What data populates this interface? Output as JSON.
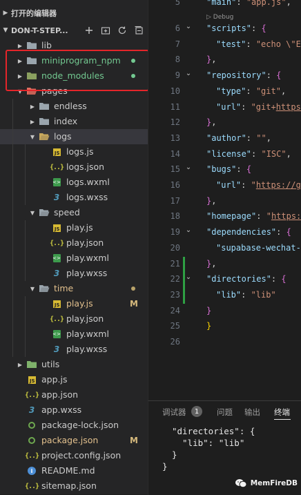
{
  "explorer": {
    "open_editors_label": "打开的编辑器",
    "project_label": "DON-T-STEP...",
    "actions": [
      "new-file-icon",
      "new-folder-icon",
      "refresh-icon",
      "collapse-all-icon"
    ],
    "items": [
      {
        "label": "lib",
        "type": "folder",
        "open": false,
        "indent": 0,
        "color": "#cccccc"
      },
      {
        "label": "miniprogram_npm",
        "type": "folder",
        "open": false,
        "indent": 0,
        "color": "#73c991",
        "dot": true
      },
      {
        "label": "node_modules",
        "type": "folder-node",
        "open": false,
        "indent": 0,
        "color": "#73c991",
        "dot": true
      },
      {
        "label": "pages",
        "type": "folder-pages",
        "open": true,
        "indent": 0,
        "color": "#cccccc"
      },
      {
        "label": "endless",
        "type": "folder",
        "open": false,
        "indent": 1,
        "color": "#cccccc"
      },
      {
        "label": "index",
        "type": "folder",
        "open": false,
        "indent": 1,
        "color": "#cccccc"
      },
      {
        "label": "logs",
        "type": "folder-logs",
        "open": true,
        "indent": 1,
        "color": "#cccccc",
        "selected": true
      },
      {
        "label": "logs.js",
        "type": "js",
        "indent": 2,
        "color": "#cccccc"
      },
      {
        "label": "logs.json",
        "type": "json",
        "indent": 2,
        "color": "#cccccc"
      },
      {
        "label": "logs.wxml",
        "type": "wxml",
        "indent": 2,
        "color": "#cccccc"
      },
      {
        "label": "logs.wxss",
        "type": "wxss",
        "indent": 2,
        "color": "#cccccc"
      },
      {
        "label": "speed",
        "type": "folder",
        "open": true,
        "indent": 1,
        "color": "#cccccc"
      },
      {
        "label": "play.js",
        "type": "js",
        "indent": 2,
        "color": "#cccccc"
      },
      {
        "label": "play.json",
        "type": "json",
        "indent": 2,
        "color": "#cccccc"
      },
      {
        "label": "play.wxml",
        "type": "wxml",
        "indent": 2,
        "color": "#cccccc"
      },
      {
        "label": "play.wxss",
        "type": "wxss",
        "indent": 2,
        "color": "#cccccc"
      },
      {
        "label": "time",
        "type": "folder",
        "open": true,
        "indent": 1,
        "color": "#e2c08d",
        "dotc": true
      },
      {
        "label": "play.js",
        "type": "js",
        "indent": 2,
        "color": "#e2c08d",
        "badge": "M"
      },
      {
        "label": "play.json",
        "type": "json",
        "indent": 2,
        "color": "#cccccc"
      },
      {
        "label": "play.wxml",
        "type": "wxml",
        "indent": 2,
        "color": "#cccccc"
      },
      {
        "label": "play.wxss",
        "type": "wxss",
        "indent": 2,
        "color": "#cccccc"
      },
      {
        "label": "utils",
        "type": "folder-utils",
        "open": false,
        "indent": 0,
        "color": "#cccccc"
      },
      {
        "label": "app.js",
        "type": "js",
        "indent": 0,
        "leaf": true,
        "color": "#cccccc"
      },
      {
        "label": "app.json",
        "type": "json",
        "indent": 0,
        "leaf": true,
        "color": "#cccccc"
      },
      {
        "label": "app.wxss",
        "type": "wxss",
        "indent": 0,
        "leaf": true,
        "color": "#cccccc"
      },
      {
        "label": "package-lock.json",
        "type": "lock",
        "indent": 0,
        "leaf": true,
        "color": "#cccccc"
      },
      {
        "label": "package.json",
        "type": "lock",
        "indent": 0,
        "leaf": true,
        "color": "#e2c08d",
        "badge": "M"
      },
      {
        "label": "project.config.json",
        "type": "json",
        "indent": 0,
        "leaf": true,
        "color": "#cccccc"
      },
      {
        "label": "README.md",
        "type": "md",
        "indent": 0,
        "leaf": true,
        "color": "#cccccc"
      },
      {
        "label": "sitemap.json",
        "type": "json",
        "indent": 0,
        "leaf": true,
        "color": "#cccccc"
      }
    ]
  },
  "editor": {
    "debug_label": "▷ Debug",
    "lines": [
      {
        "n": "5",
        "fold": false,
        "parts": [
          [
            "k",
            "\"main\""
          ],
          [
            "p",
            ": "
          ],
          [
            "s",
            "\"app.js\""
          ],
          [
            "p",
            ","
          ]
        ]
      },
      {
        "n": "6",
        "fold": true,
        "parts": [
          [
            "k",
            "\"scripts\""
          ],
          [
            "p",
            ": "
          ],
          [
            "bb",
            "{"
          ]
        ]
      },
      {
        "n": "7",
        "fold": false,
        "indent": 1,
        "parts": [
          [
            "k",
            "\"test\""
          ],
          [
            "p",
            ": "
          ],
          [
            "s",
            "\"echo \\\"Err"
          ]
        ]
      },
      {
        "n": "8",
        "fold": false,
        "parts": [
          [
            "bb",
            "}"
          ],
          [
            "p",
            ","
          ]
        ]
      },
      {
        "n": "9",
        "fold": true,
        "parts": [
          [
            "k",
            "\"repository\""
          ],
          [
            "p",
            ": "
          ],
          [
            "bb",
            "{"
          ]
        ]
      },
      {
        "n": "10",
        "fold": false,
        "indent": 1,
        "parts": [
          [
            "k",
            "\"type\""
          ],
          [
            "p",
            ": "
          ],
          [
            "s",
            "\"git\""
          ],
          [
            "p",
            ","
          ]
        ]
      },
      {
        "n": "11",
        "fold": false,
        "indent": 1,
        "parts": [
          [
            "k",
            "\"url\""
          ],
          [
            "p",
            ": "
          ],
          [
            "s",
            "\"git+"
          ],
          [
            "u",
            "https:/"
          ]
        ]
      },
      {
        "n": "12",
        "fold": false,
        "parts": [
          [
            "bb",
            "}"
          ],
          [
            "p",
            ","
          ]
        ]
      },
      {
        "n": "13",
        "fold": false,
        "parts": [
          [
            "k",
            "\"author\""
          ],
          [
            "p",
            ": "
          ],
          [
            "s",
            "\"\""
          ],
          [
            "p",
            ","
          ]
        ]
      },
      {
        "n": "14",
        "fold": false,
        "parts": [
          [
            "k",
            "\"license\""
          ],
          [
            "p",
            ": "
          ],
          [
            "s",
            "\"ISC\""
          ],
          [
            "p",
            ","
          ]
        ]
      },
      {
        "n": "15",
        "fold": true,
        "parts": [
          [
            "k",
            "\"bugs\""
          ],
          [
            "p",
            ": "
          ],
          [
            "bb",
            "{"
          ]
        ]
      },
      {
        "n": "16",
        "fold": false,
        "indent": 1,
        "parts": [
          [
            "k",
            "\"url\""
          ],
          [
            "p",
            ": "
          ],
          [
            "s",
            "\""
          ],
          [
            "u",
            "https://git"
          ]
        ]
      },
      {
        "n": "17",
        "fold": false,
        "parts": [
          [
            "bb",
            "}"
          ],
          [
            "p",
            ","
          ]
        ]
      },
      {
        "n": "18",
        "fold": false,
        "parts": [
          [
            "k",
            "\"homepage\""
          ],
          [
            "p",
            ": "
          ],
          [
            "s",
            "\""
          ],
          [
            "u",
            "https:/"
          ]
        ]
      },
      {
        "n": "19",
        "fold": true,
        "parts": [
          [
            "k",
            "\"dependencies\""
          ],
          [
            "p",
            ": "
          ],
          [
            "bb",
            "{"
          ]
        ]
      },
      {
        "n": "20",
        "fold": false,
        "indent": 1,
        "parts": [
          [
            "k",
            "\"supabase-wechat-st"
          ]
        ]
      },
      {
        "n": "21",
        "fold": false,
        "mark": true,
        "parts": [
          [
            "bb",
            "}"
          ],
          [
            "p",
            ","
          ]
        ]
      },
      {
        "n": "22",
        "fold": true,
        "mark": true,
        "parts": [
          [
            "k",
            "\"directories\""
          ],
          [
            "p",
            ": "
          ],
          [
            "bb",
            "{"
          ]
        ]
      },
      {
        "n": "23",
        "fold": false,
        "mark": true,
        "indent": 1,
        "parts": [
          [
            "k",
            "\"lib\""
          ],
          [
            "p",
            ": "
          ],
          [
            "s",
            "\"lib\""
          ]
        ]
      },
      {
        "n": "24",
        "fold": false,
        "parts": [
          [
            "bb",
            "}"
          ]
        ]
      },
      {
        "n": "25",
        "fold": false,
        "parts": [
          [
            "b",
            "}"
          ]
        ]
      },
      {
        "n": "26",
        "fold": false,
        "parts": []
      }
    ]
  },
  "panel": {
    "tabs": [
      {
        "label": "调试器",
        "active": false
      },
      {
        "label": "问题",
        "active": false
      },
      {
        "label": "输出",
        "active": false
      },
      {
        "label": "终端",
        "active": true
      }
    ],
    "debugger_badge": "1",
    "terminal_lines": [
      "\"directories\": {",
      "  \"lib\": \"lib\"",
      "}",
      "}"
    ],
    "watermark": "MemFireDB"
  },
  "colors": {
    "modified": "#e2c08d",
    "untracked": "#73c991",
    "annotation_box": "#e5252a"
  }
}
